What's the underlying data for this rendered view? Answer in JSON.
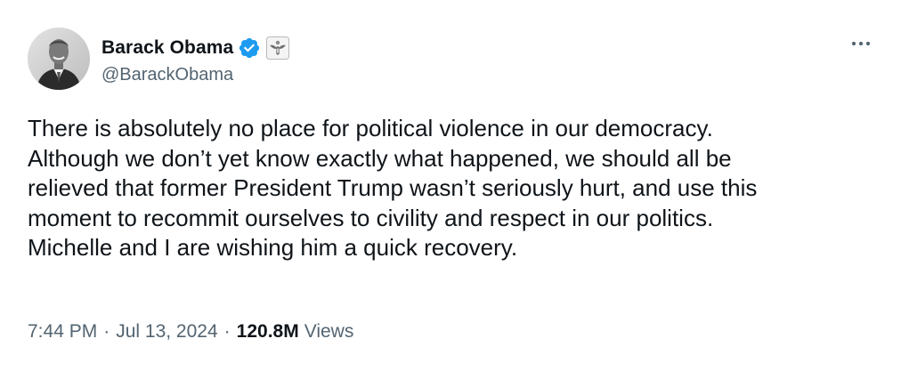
{
  "tweet": {
    "author": {
      "display_name": "Barack Obama",
      "handle": "@BarackObama",
      "verified_icon": "verified-badge-icon",
      "affiliation_icon": "government-seal-icon",
      "avatar_icon": "avatar-photo"
    },
    "more_icon": "more-horizontal-icon",
    "text": "There is absolutely no place for political violence in our democracy.\nAlthough we don’t yet know exactly what happened, we should all be\nrelieved that former President Trump wasn’t seriously hurt, and use this\nmoment to recommit ourselves to civility and respect in our politics.\nMichelle and I are wishing him a quick recovery.",
    "meta": {
      "time": "7:44 PM",
      "separator": "·",
      "date": "Jul 13, 2024",
      "views_count": "120.8M",
      "views_label": "Views"
    }
  },
  "colors": {
    "verified_blue": "#1d9bf0",
    "text_primary": "#0f1419",
    "text_secondary": "#536471"
  }
}
